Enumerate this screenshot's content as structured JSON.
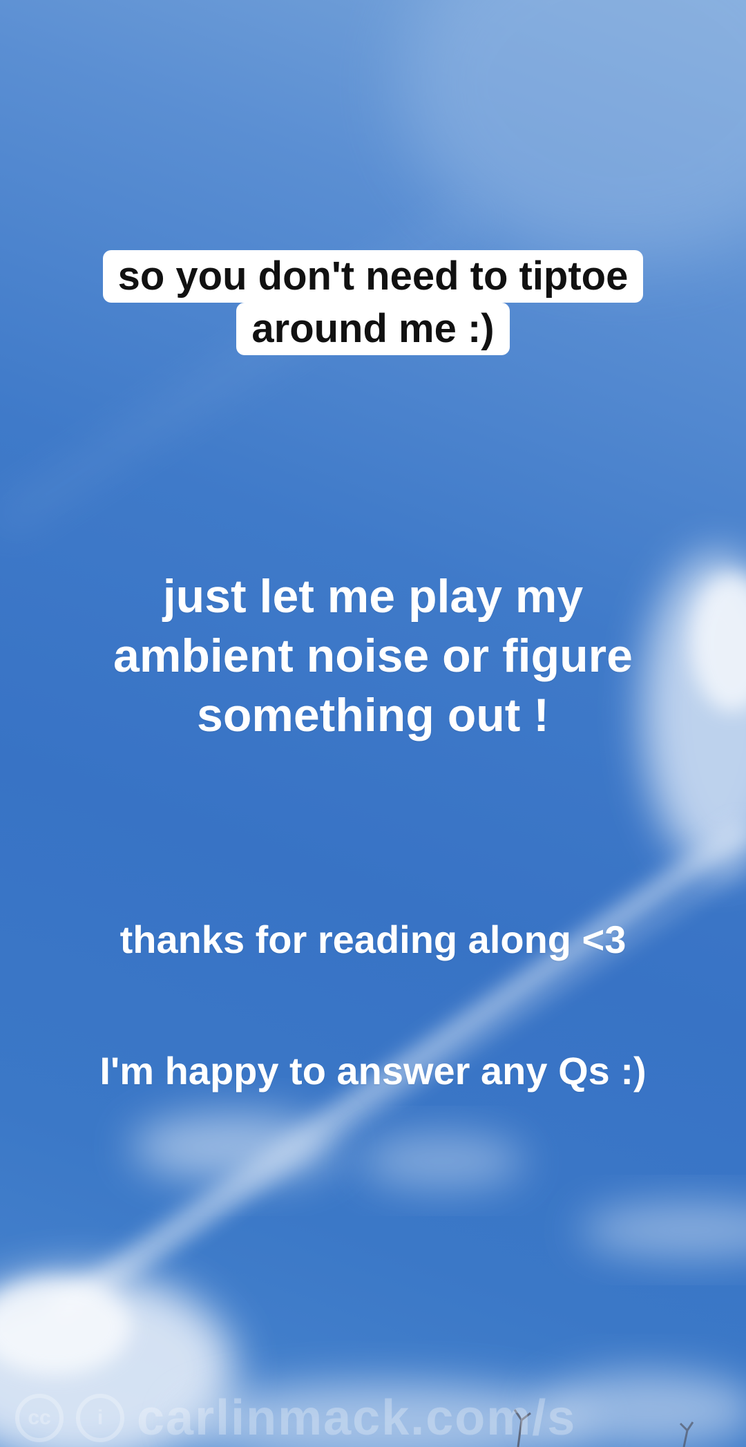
{
  "captions": {
    "boxed_lines": [
      "so you don't need to tiptoe",
      "around me :)"
    ],
    "big_lines": [
      "just let me play my",
      "ambient noise or figure",
      "something out !"
    ],
    "thanks": "thanks for reading along <3",
    "questions": "I'm happy to answer any Qs :)"
  },
  "watermark": {
    "cc_symbol": "cc",
    "info_symbol": "i",
    "text": "carlinmack.com/s"
  },
  "colors": {
    "sky_top": "#7aa6da",
    "sky_mid": "#3873c5",
    "caption_box": "#ffffff",
    "caption_box_text": "#111111",
    "caption_text": "#ffffff"
  }
}
